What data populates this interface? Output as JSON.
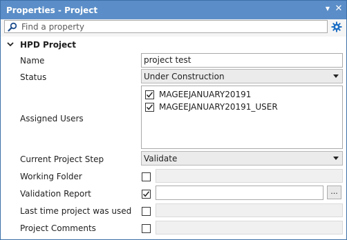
{
  "window": {
    "title": "Properties - Project",
    "pin_glyph": "▼",
    "close_glyph": "✕"
  },
  "search": {
    "placeholder": "Find a property",
    "value": ""
  },
  "icons": {
    "search": "search-icon",
    "settings": "gear-icon",
    "collapse": "chevron-down-icon"
  },
  "category": {
    "label": "HPD Project",
    "expanded": true
  },
  "properties": {
    "name": {
      "label": "Name",
      "value": "project test"
    },
    "status": {
      "label": "Status",
      "value": "Under Construction"
    },
    "assigned_users": {
      "label": "Assigned Users",
      "users": [
        {
          "label": "MAGEEJANUARY20191",
          "checked": true
        },
        {
          "label": "MAGEEJANUARY20191_USER",
          "checked": true
        }
      ]
    },
    "current_step": {
      "label": "Current Project Step",
      "value": "Validate"
    },
    "working_folder": {
      "label": "Working Folder",
      "checked": false,
      "value": ""
    },
    "validation_report": {
      "label": "Validation Report",
      "checked": true,
      "value": "",
      "browse_label": "..."
    },
    "last_used": {
      "label": "Last time project was used",
      "checked": false,
      "value": ""
    },
    "comments": {
      "label": "Project Comments",
      "checked": false,
      "value": ""
    }
  },
  "colors": {
    "titlebar": "#5b8ec8",
    "accent": "#1f6fc5"
  }
}
